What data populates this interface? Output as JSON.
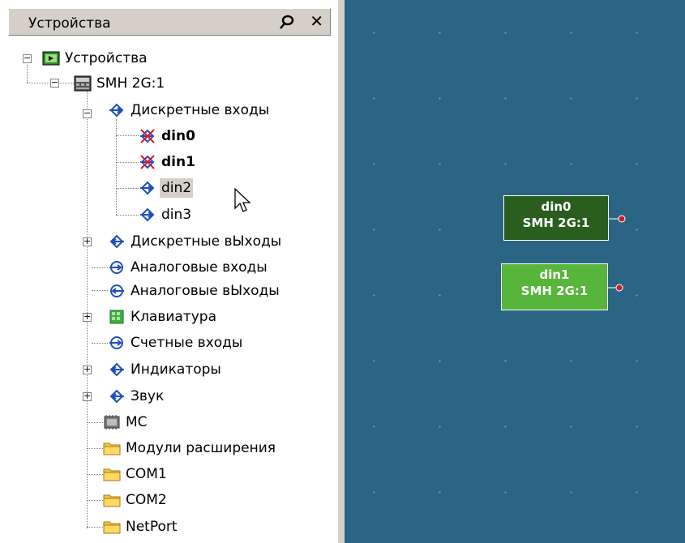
{
  "panel": {
    "title": "Устройства",
    "pin_icon": "pin-icon",
    "close_label": "✕"
  },
  "tree": {
    "root": "Устройства",
    "device": "SMH 2G:1",
    "discrete_inputs": "Дискретные входы",
    "din0": "din0",
    "din1": "din1",
    "din2": "din2",
    "din3": "din3",
    "discrete_outputs": "Дискретные вЫходы",
    "analog_inputs": "Аналоговые входы",
    "analog_outputs": "Аналоговые вЫходы",
    "keyboard": "Клавиатура",
    "counter_inputs": "Счетные входы",
    "indicators": "Индикаторы",
    "sound": "Звук",
    "mc": "MC",
    "ext_modules": "Модули расширения",
    "com1": "COM1",
    "com2": "COM2",
    "netport": "NetPort"
  },
  "canvas": {
    "nodes": [
      {
        "line1": "din0",
        "line2": "SMH 2G:1",
        "color": "#295e1f"
      },
      {
        "line1": "din1",
        "line2": "SMH 2G:1",
        "color": "#56b53a"
      }
    ],
    "background": "#2a6684"
  },
  "colors": {
    "port_dot": "#cc1f1f",
    "selection_bg": "#d4d0c8"
  }
}
